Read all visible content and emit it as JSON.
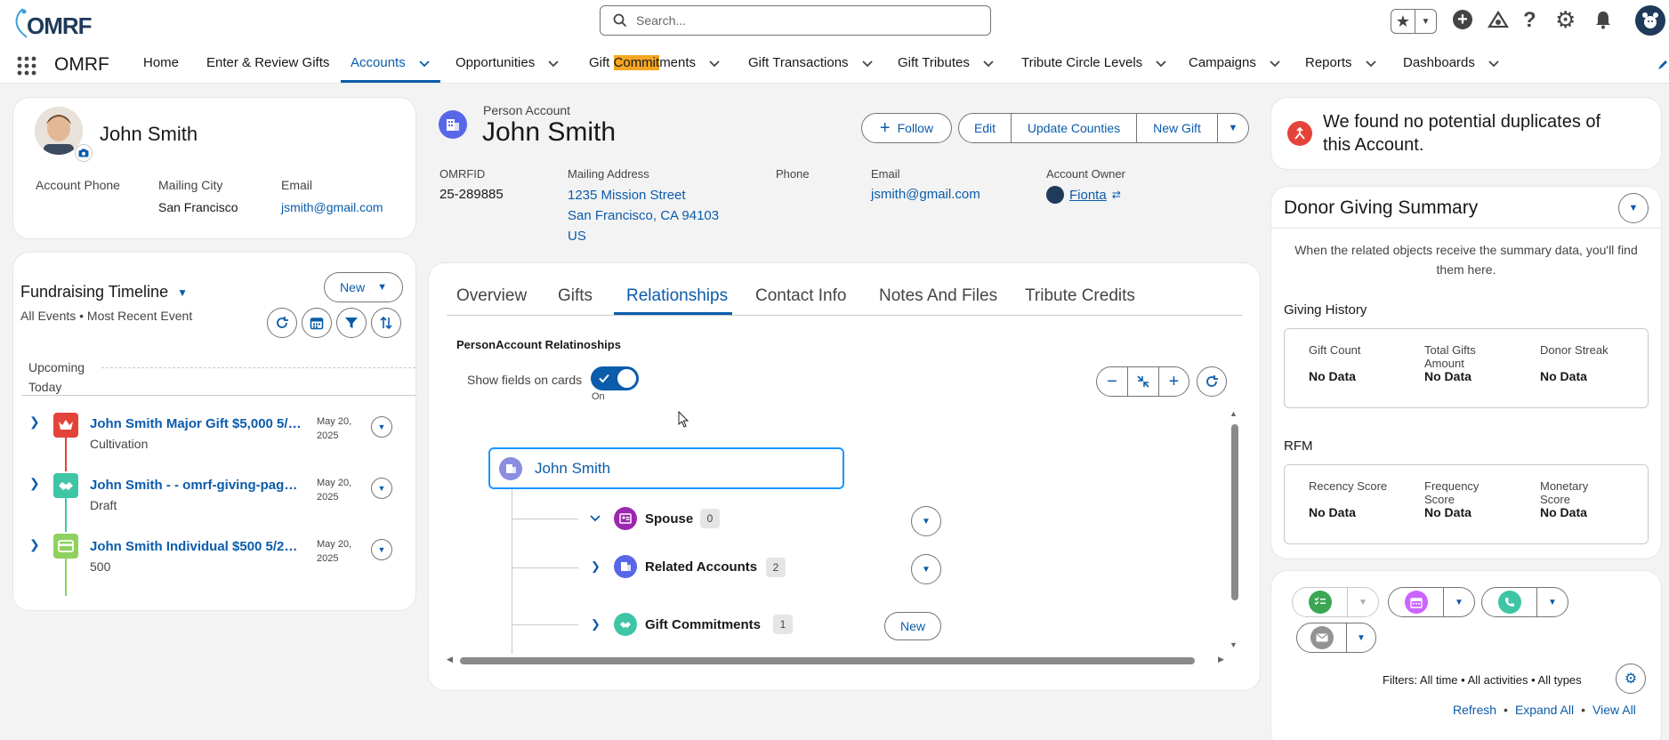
{
  "app": {
    "logo_text": "OMRF",
    "name": "OMRF",
    "search_placeholder": "Search..."
  },
  "nav": [
    {
      "label": "Home"
    },
    {
      "label": "Enter & Review Gifts"
    },
    {
      "label": "Accounts"
    },
    {
      "label": "Opportunities"
    },
    {
      "label_pre": "Gift ",
      "label_hl": "Commit",
      "label_post": "ments"
    },
    {
      "label": "Gift Transactions"
    },
    {
      "label": "Gift Tributes"
    },
    {
      "label": "Tribute Circle Levels"
    },
    {
      "label": "Campaigns"
    },
    {
      "label": "Reports"
    },
    {
      "label": "Dashboards"
    }
  ],
  "profile": {
    "name": "John Smith",
    "fields": [
      {
        "label": "Account Phone",
        "value": ""
      },
      {
        "label": "Mailing City",
        "value": "San Francisco"
      },
      {
        "label": "Email",
        "value": "jsmith@gmail.com"
      }
    ]
  },
  "timeline": {
    "title": "Fundraising Timeline",
    "filter_text": "All Events • Most Recent Event",
    "new_label": "New",
    "upcoming": "Upcoming",
    "today": "Today",
    "items": [
      {
        "title": "John Smith Major Gift $5,000 5/2...",
        "sub": "Cultivation",
        "date1": "May 20,",
        "date2": "2025",
        "color": "#e4433a"
      },
      {
        "title": "John Smith - - omrf-giving-page -...",
        "sub": "Draft",
        "date1": "May 20,",
        "date2": "2025",
        "color": "#3ec5a6"
      },
      {
        "title": "John Smith Individual $500 5/20/...",
        "sub": "500",
        "date1": "May 20,",
        "date2": "2025",
        "color": "#8fd15e"
      }
    ]
  },
  "record": {
    "type_label": "Person Account",
    "name": "John Smith",
    "follow_label": "Follow",
    "actions": [
      "Edit",
      "Update Counties",
      "New Gift"
    ],
    "fields": {
      "omrfid_label": "OMRFID",
      "omrfid": "25-289885",
      "address_label": "Mailing Address",
      "address1": "1235 Mission Street",
      "address2": "San Francisco, CA 94103",
      "address3": "US",
      "phone_label": "Phone",
      "phone": "",
      "email_label": "Email",
      "email": "jsmith@gmail.com",
      "owner_label": "Account Owner",
      "owner": "Fionta"
    }
  },
  "tabs": [
    "Overview",
    "Gifts",
    "Relationships",
    "Contact Info",
    "Notes And Files",
    "Tribute Credits"
  ],
  "active_tab": "Relationships",
  "relationships": {
    "heading": "PersonAccount Relatinoships",
    "toggle_label": "Show fields on cards",
    "toggle_state": "On",
    "root": "John Smith",
    "children": [
      {
        "label": "Spouse",
        "count": "0",
        "color": "#9c27b0"
      },
      {
        "label": "Related Accounts",
        "count": "2",
        "color": "#5867e8"
      },
      {
        "label": "Gift Commitments",
        "count": "1",
        "color": "#3ec5a6"
      }
    ],
    "new_label": "New"
  },
  "duplicates": {
    "text1": "We found no potential duplicates of",
    "text2": "this Account."
  },
  "summary": {
    "title": "Donor Giving Summary",
    "note1": "When the related objects receive the summary data, you'll find",
    "note2": "them here.",
    "giving_history": "Giving History",
    "gh_stats": [
      {
        "label1": "Gift Count",
        "label2": "",
        "value": "No Data"
      },
      {
        "label1": "Total Gifts",
        "label2": "Amount",
        "value": "No Data"
      },
      {
        "label1": "Donor Streak",
        "label2": "",
        "value": "No Data"
      }
    ],
    "rfm": "RFM",
    "rfm_stats": [
      {
        "label1": "Recency Score",
        "label2": "",
        "value": "No Data"
      },
      {
        "label1": "Frequency",
        "label2": "Score",
        "value": "No Data"
      },
      {
        "label1": "Monetary",
        "label2": "Score",
        "value": "No Data"
      }
    ]
  },
  "activity": {
    "filters": "Filters: All time • All activities • All types",
    "refresh": "Refresh",
    "expand_all": "Expand All",
    "view_all": "View All"
  }
}
